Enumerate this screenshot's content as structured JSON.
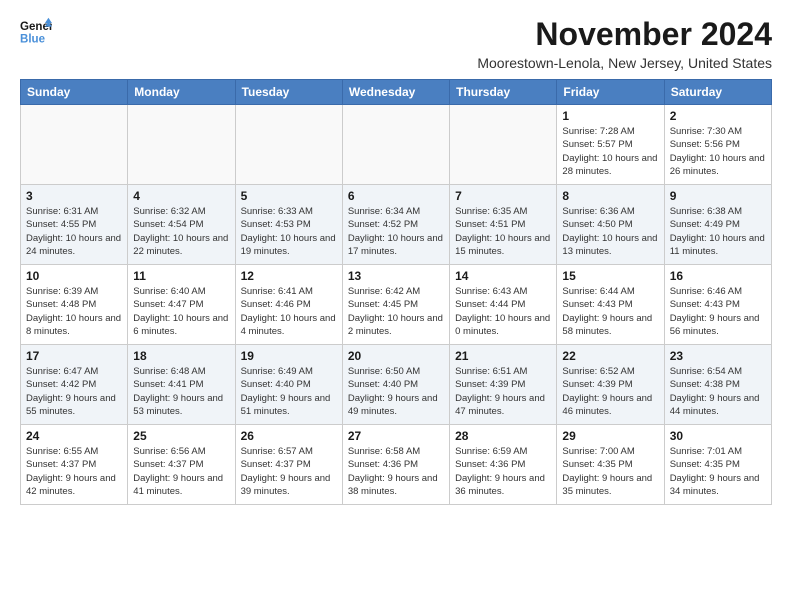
{
  "header": {
    "logo_line1": "General",
    "logo_line2": "Blue",
    "month_title": "November 2024",
    "location": "Moorestown-Lenola, New Jersey, United States"
  },
  "weekdays": [
    "Sunday",
    "Monday",
    "Tuesday",
    "Wednesday",
    "Thursday",
    "Friday",
    "Saturday"
  ],
  "weeks": [
    [
      {
        "day": "",
        "info": ""
      },
      {
        "day": "",
        "info": ""
      },
      {
        "day": "",
        "info": ""
      },
      {
        "day": "",
        "info": ""
      },
      {
        "day": "",
        "info": ""
      },
      {
        "day": "1",
        "info": "Sunrise: 7:28 AM\nSunset: 5:57 PM\nDaylight: 10 hours and 28 minutes."
      },
      {
        "day": "2",
        "info": "Sunrise: 7:30 AM\nSunset: 5:56 PM\nDaylight: 10 hours and 26 minutes."
      }
    ],
    [
      {
        "day": "3",
        "info": "Sunrise: 6:31 AM\nSunset: 4:55 PM\nDaylight: 10 hours and 24 minutes."
      },
      {
        "day": "4",
        "info": "Sunrise: 6:32 AM\nSunset: 4:54 PM\nDaylight: 10 hours and 22 minutes."
      },
      {
        "day": "5",
        "info": "Sunrise: 6:33 AM\nSunset: 4:53 PM\nDaylight: 10 hours and 19 minutes."
      },
      {
        "day": "6",
        "info": "Sunrise: 6:34 AM\nSunset: 4:52 PM\nDaylight: 10 hours and 17 minutes."
      },
      {
        "day": "7",
        "info": "Sunrise: 6:35 AM\nSunset: 4:51 PM\nDaylight: 10 hours and 15 minutes."
      },
      {
        "day": "8",
        "info": "Sunrise: 6:36 AM\nSunset: 4:50 PM\nDaylight: 10 hours and 13 minutes."
      },
      {
        "day": "9",
        "info": "Sunrise: 6:38 AM\nSunset: 4:49 PM\nDaylight: 10 hours and 11 minutes."
      }
    ],
    [
      {
        "day": "10",
        "info": "Sunrise: 6:39 AM\nSunset: 4:48 PM\nDaylight: 10 hours and 8 minutes."
      },
      {
        "day": "11",
        "info": "Sunrise: 6:40 AM\nSunset: 4:47 PM\nDaylight: 10 hours and 6 minutes."
      },
      {
        "day": "12",
        "info": "Sunrise: 6:41 AM\nSunset: 4:46 PM\nDaylight: 10 hours and 4 minutes."
      },
      {
        "day": "13",
        "info": "Sunrise: 6:42 AM\nSunset: 4:45 PM\nDaylight: 10 hours and 2 minutes."
      },
      {
        "day": "14",
        "info": "Sunrise: 6:43 AM\nSunset: 4:44 PM\nDaylight: 10 hours and 0 minutes."
      },
      {
        "day": "15",
        "info": "Sunrise: 6:44 AM\nSunset: 4:43 PM\nDaylight: 9 hours and 58 minutes."
      },
      {
        "day": "16",
        "info": "Sunrise: 6:46 AM\nSunset: 4:43 PM\nDaylight: 9 hours and 56 minutes."
      }
    ],
    [
      {
        "day": "17",
        "info": "Sunrise: 6:47 AM\nSunset: 4:42 PM\nDaylight: 9 hours and 55 minutes."
      },
      {
        "day": "18",
        "info": "Sunrise: 6:48 AM\nSunset: 4:41 PM\nDaylight: 9 hours and 53 minutes."
      },
      {
        "day": "19",
        "info": "Sunrise: 6:49 AM\nSunset: 4:40 PM\nDaylight: 9 hours and 51 minutes."
      },
      {
        "day": "20",
        "info": "Sunrise: 6:50 AM\nSunset: 4:40 PM\nDaylight: 9 hours and 49 minutes."
      },
      {
        "day": "21",
        "info": "Sunrise: 6:51 AM\nSunset: 4:39 PM\nDaylight: 9 hours and 47 minutes."
      },
      {
        "day": "22",
        "info": "Sunrise: 6:52 AM\nSunset: 4:39 PM\nDaylight: 9 hours and 46 minutes."
      },
      {
        "day": "23",
        "info": "Sunrise: 6:54 AM\nSunset: 4:38 PM\nDaylight: 9 hours and 44 minutes."
      }
    ],
    [
      {
        "day": "24",
        "info": "Sunrise: 6:55 AM\nSunset: 4:37 PM\nDaylight: 9 hours and 42 minutes."
      },
      {
        "day": "25",
        "info": "Sunrise: 6:56 AM\nSunset: 4:37 PM\nDaylight: 9 hours and 41 minutes."
      },
      {
        "day": "26",
        "info": "Sunrise: 6:57 AM\nSunset: 4:37 PM\nDaylight: 9 hours and 39 minutes."
      },
      {
        "day": "27",
        "info": "Sunrise: 6:58 AM\nSunset: 4:36 PM\nDaylight: 9 hours and 38 minutes."
      },
      {
        "day": "28",
        "info": "Sunrise: 6:59 AM\nSunset: 4:36 PM\nDaylight: 9 hours and 36 minutes."
      },
      {
        "day": "29",
        "info": "Sunrise: 7:00 AM\nSunset: 4:35 PM\nDaylight: 9 hours and 35 minutes."
      },
      {
        "day": "30",
        "info": "Sunrise: 7:01 AM\nSunset: 4:35 PM\nDaylight: 9 hours and 34 minutes."
      }
    ]
  ],
  "alt_rows": [
    1,
    3
  ]
}
